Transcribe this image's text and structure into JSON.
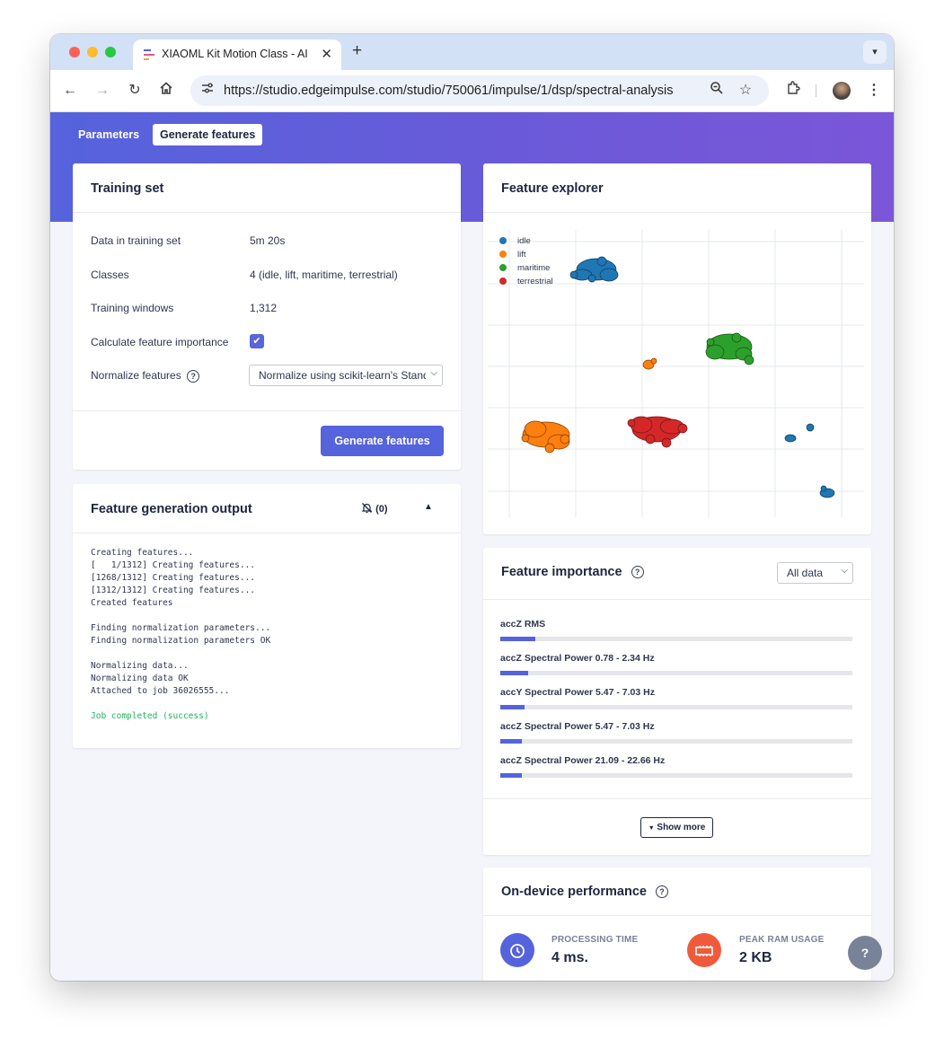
{
  "browser": {
    "tab_title": "XIAOML Kit Motion Class - AI",
    "url": "https://studio.edgeimpulse.com/studio/750061/impulse/1/dsp/spectral-analysis",
    "colors": {
      "close": "#fe5f57",
      "minimize": "#febc2e",
      "maximize": "#28c840"
    }
  },
  "nav": {
    "tab_parameters": "Parameters",
    "tab_generate": "Generate features"
  },
  "training_set": {
    "title": "Training set",
    "rows": [
      {
        "label": "Data in training set",
        "value": "5m 20s"
      },
      {
        "label": "Classes",
        "value": "4 (idle, lift, maritime, terrestrial)"
      },
      {
        "label": "Training windows",
        "value": "1,312"
      }
    ],
    "importance_label": "Calculate feature importance",
    "importance_checked": true,
    "normalize_label": "Normalize features",
    "normalize_value": "Normalize using scikit-learn's StandardScaler",
    "generate_button": "Generate features"
  },
  "output": {
    "title": "Feature generation output",
    "notifications": "(0)",
    "log": [
      "Creating features...",
      "[   1/1312] Creating features...",
      "[1268/1312] Creating features...",
      "[1312/1312] Creating features...",
      "Created features",
      "",
      "Finding normalization parameters...",
      "Finding normalization parameters OK",
      "",
      "Normalizing data...",
      "Normalizing data OK",
      "Attached to job 36026555...",
      ""
    ],
    "success": "Job completed (success)"
  },
  "explorer": {
    "title": "Feature explorer",
    "legend": [
      {
        "name": "idle",
        "color": "#1f77b4"
      },
      {
        "name": "lift",
        "color": "#ff7f0e"
      },
      {
        "name": "maritime",
        "color": "#2ca02c"
      },
      {
        "name": "terrestrial",
        "color": "#d62728"
      }
    ]
  },
  "importance": {
    "title": "Feature importance",
    "filter": "All data",
    "items": [
      {
        "label": "accZ RMS",
        "value": 0.1
      },
      {
        "label": "accZ Spectral Power 0.78 - 2.34 Hz",
        "value": 0.08
      },
      {
        "label": "accY Spectral Power 5.47 - 7.03 Hz",
        "value": 0.07
      },
      {
        "label": "accZ Spectral Power 5.47 - 7.03 Hz",
        "value": 0.06
      },
      {
        "label": "accZ Spectral Power 21.09 - 22.66 Hz",
        "value": 0.06
      }
    ],
    "show_more": "Show more"
  },
  "performance": {
    "title": "On-device performance",
    "processing_label": "PROCESSING TIME",
    "processing_value": "4 ms.",
    "ram_label": "PEAK RAM USAGE",
    "ram_value": "2 KB"
  },
  "help_button": "?"
}
